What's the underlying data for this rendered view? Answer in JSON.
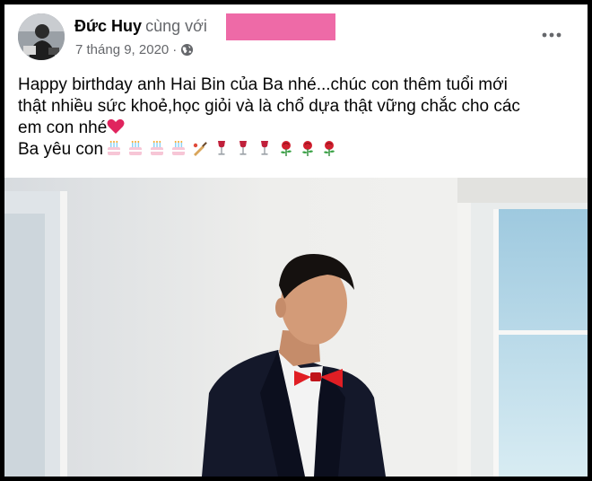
{
  "post": {
    "author": "Đức Huy",
    "with_text": "cùng với",
    "date": "7 tháng 9, 2020",
    "separator": "·",
    "privacy_icon": "globe-icon",
    "more_icon": "more-options-icon",
    "text_lines": [
      "Happy birthday anh Hai Bin của Ba nhé...chúc con thêm tuổi mới",
      "thật nhiều sức khoẻ,học giỏi và là chổ dựa thật vững chắc cho các",
      "em con nhé",
      "Ba yêu con"
    ],
    "emojis": [
      "cake-emoji",
      "cake-emoji",
      "cake-emoji",
      "cake-emoji",
      "cricket-bat-emoji",
      "wine-glass-emoji",
      "wine-glass-emoji",
      "wine-glass-emoji",
      "rose-emoji",
      "rose-emoji",
      "rose-emoji"
    ],
    "heart_emoji": "red-heart-emoji"
  },
  "colors": {
    "redaction": "#ee6aa7",
    "meta_text": "#65676b",
    "text": "#050505"
  }
}
